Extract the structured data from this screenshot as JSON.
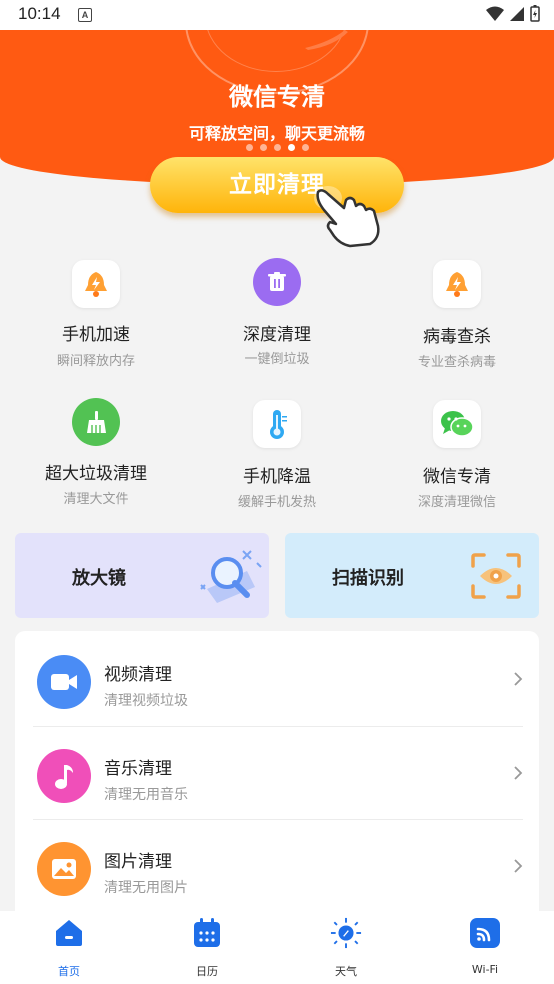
{
  "status_bar": {
    "time": "10:14",
    "notification_badge": "A"
  },
  "hero": {
    "title": "微信专清",
    "subtitle": "可释放空间，聊天更流畅",
    "dots_count": 5,
    "active_dot": 3,
    "button_label": "立即清理",
    "color": "#ff5a12"
  },
  "tools": [
    {
      "title": "手机加速",
      "sub": "瞬间释放内存",
      "icon": "rocket-bell-icon"
    },
    {
      "title": "深度清理",
      "sub": "一键倒垃圾",
      "icon": "trash-icon"
    },
    {
      "title": "病毒查杀",
      "sub": "专业查杀病毒",
      "icon": "shield-bell-icon"
    },
    {
      "title": "超大垃圾清理",
      "sub": "清理大文件",
      "icon": "broom-icon"
    },
    {
      "title": "手机降温",
      "sub": "缓解手机发热",
      "icon": "thermometer-icon"
    },
    {
      "title": "微信专清",
      "sub": "深度清理微信",
      "icon": "wechat-icon"
    }
  ],
  "cards": {
    "left": {
      "label": "放大镜",
      "icon": "magnifier-icon"
    },
    "right": {
      "label": "扫描识别",
      "icon": "scan-eye-icon"
    }
  },
  "list": [
    {
      "title": "视频清理",
      "sub": "清理视频垃圾",
      "icon": "video-icon",
      "color": "#4a8cf5"
    },
    {
      "title": "音乐清理",
      "sub": "清理无用音乐",
      "icon": "music-icon",
      "color": "#f04fb9"
    },
    {
      "title": "图片清理",
      "sub": "清理无用图片",
      "icon": "image-icon",
      "color": "#ff9431"
    }
  ],
  "nav": [
    {
      "label": "首页",
      "icon": "home-icon",
      "active": true
    },
    {
      "label": "日历",
      "icon": "calendar-icon",
      "active": false
    },
    {
      "label": "天气",
      "icon": "weather-compass-icon",
      "active": false
    },
    {
      "label": "Wi-Fi",
      "icon": "wifi-icon",
      "active": false
    }
  ],
  "accent": "#1e6ee8"
}
